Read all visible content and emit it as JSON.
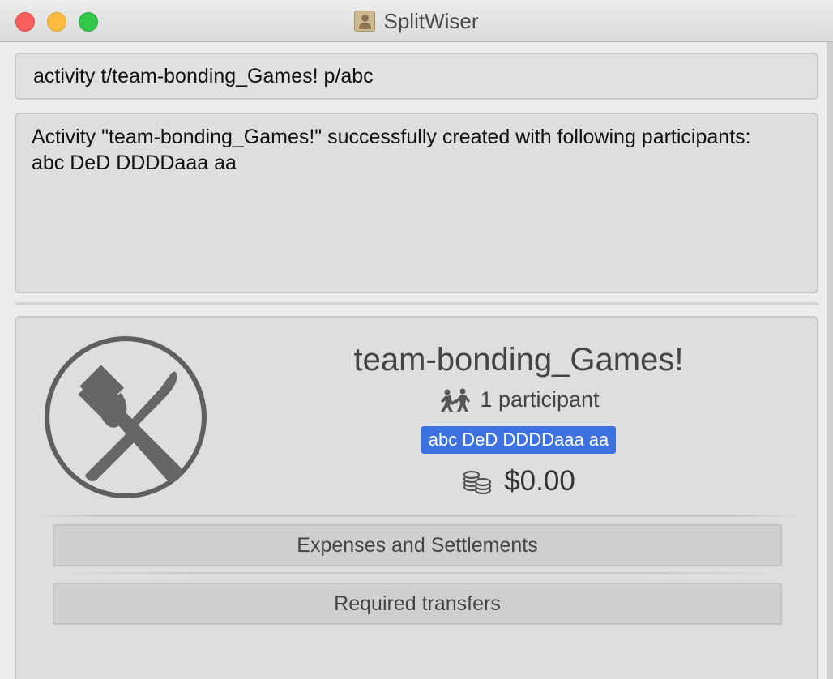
{
  "window": {
    "title": "SplitWiser"
  },
  "command": {
    "value": "activity t/team-bonding_Games! p/abc"
  },
  "result": {
    "line1": "Activity \"team-bonding_Games!\" successfully created with following participants:",
    "line2": "abc DeD DDDDaaa aa"
  },
  "activity": {
    "name": "team-bonding_Games!",
    "icon": "fork-knife-icon",
    "participants_count_label": "1 participant",
    "participants": [
      "abc DeD DDDDaaa aa"
    ],
    "total": "$0.00"
  },
  "buttons": {
    "expenses": "Expenses and Settlements",
    "transfers": "Required transfers"
  },
  "colors": {
    "tag_bg": "#3e72e0",
    "close": "#fc605c",
    "minimize": "#fdbc40",
    "maximize": "#34c84a"
  }
}
